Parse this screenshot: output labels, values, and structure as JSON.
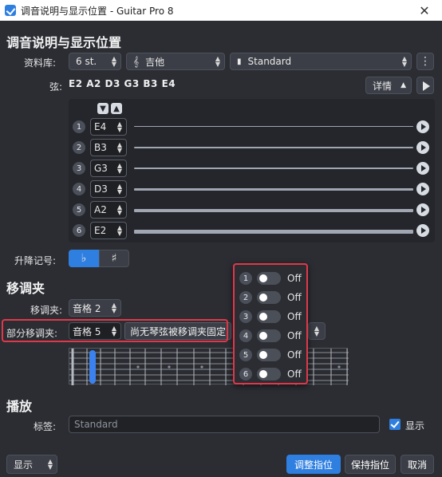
{
  "window": {
    "title": "调音说明与显示位置 - Guitar Pro 8",
    "close_glyph": "✕"
  },
  "tuning": {
    "heading": "调音说明与显示位置",
    "library_label": "资料库:",
    "library_strings_value": "6 st.",
    "instrument_value": "吉他",
    "preset_value": "Standard",
    "strings_label": "弦:",
    "strings_summary": "E2 A2 D3 G3 B3 E4",
    "details_button": "详情",
    "strings": [
      {
        "num": "1",
        "note": "E4"
      },
      {
        "num": "2",
        "note": "B3"
      },
      {
        "num": "3",
        "note": "G3"
      },
      {
        "num": "4",
        "note": "D3"
      },
      {
        "num": "5",
        "note": "A2"
      },
      {
        "num": "6",
        "note": "E2"
      }
    ],
    "accidental_label": "升降记号:",
    "flat_glyph": "♭",
    "sharp_glyph": "♯"
  },
  "capo": {
    "heading": "移调夹",
    "capo_label": "移调夹:",
    "capo_value": "音格 2",
    "partial_label": "部分移调夹:",
    "partial_value": "音格 5",
    "partial_tooltip": "尚无琴弦被移调夹固定"
  },
  "partial_popup": {
    "rows": [
      {
        "num": "1",
        "state": "Off"
      },
      {
        "num": "2",
        "state": "Off"
      },
      {
        "num": "3",
        "state": "Off"
      },
      {
        "num": "4",
        "state": "Off"
      },
      {
        "num": "5",
        "state": "Off"
      },
      {
        "num": "6",
        "state": "Off"
      }
    ]
  },
  "playback": {
    "heading": "播放",
    "tag_label": "标签:",
    "tag_placeholder": "Standard",
    "show_label": "显示"
  },
  "footer": {
    "display_button": "显示",
    "adjust_button": "调整指位",
    "keep_button": "保持指位",
    "cancel_button": "取消"
  },
  "colors": {
    "accent": "#2f7fe0",
    "highlight": "#e0384a",
    "background": "#2b2d33"
  }
}
